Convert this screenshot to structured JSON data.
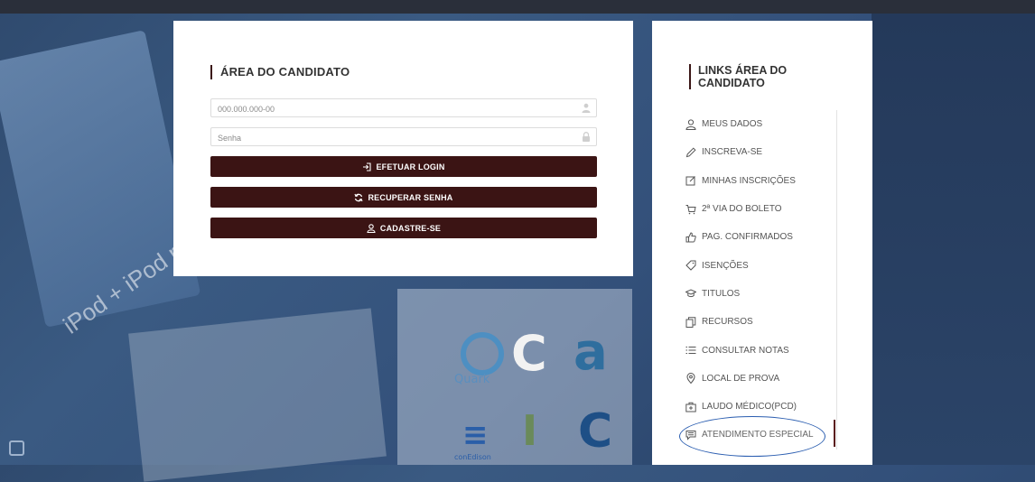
{
  "login": {
    "title": "ÁREA DO CANDIDATO",
    "cpf_placeholder": "000.000.000-00",
    "password_placeholder": "Senha",
    "login_button": "EFETUAR LOGIN",
    "recover_button": "RECUPERAR SENHA",
    "register_button": "CADASTRE-SE"
  },
  "links": {
    "title": "LINKS ÁREA DO CANDIDATO",
    "items": [
      {
        "label": "MEUS DADOS",
        "icon": "user-icon"
      },
      {
        "label": "INSCREVA-SE",
        "icon": "pencil-icon"
      },
      {
        "label": "MINHAS INSCRIÇÕES",
        "icon": "edit-icon"
      },
      {
        "label": "2ª VIA DO BOLETO",
        "icon": "cart-icon"
      },
      {
        "label": "PAG. CONFIRMADOS",
        "icon": "thumbs-up-icon"
      },
      {
        "label": "ISENÇÕES",
        "icon": "tag-icon"
      },
      {
        "label": "TITULOS",
        "icon": "graduation-cap-icon"
      },
      {
        "label": "RECURSOS",
        "icon": "documents-icon"
      },
      {
        "label": "CONSULTAR NOTAS",
        "icon": "list-icon"
      },
      {
        "label": "LOCAL DE PROVA",
        "icon": "map-pin-icon"
      },
      {
        "label": "LAUDO MÉDICO(PCD)",
        "icon": "medical-kit-icon"
      },
      {
        "label": "ATENDIMENTO ESPECIAL",
        "icon": "chat-icon"
      }
    ]
  },
  "background": {
    "ipod_text": "iPod + iPod mi",
    "logo_quark": "Quark",
    "logo_conedison": "conEdison"
  },
  "colors": {
    "button": "#3b1414",
    "accent_bar": "#3b1616",
    "highlight_ellipse": "#2a5db0"
  }
}
